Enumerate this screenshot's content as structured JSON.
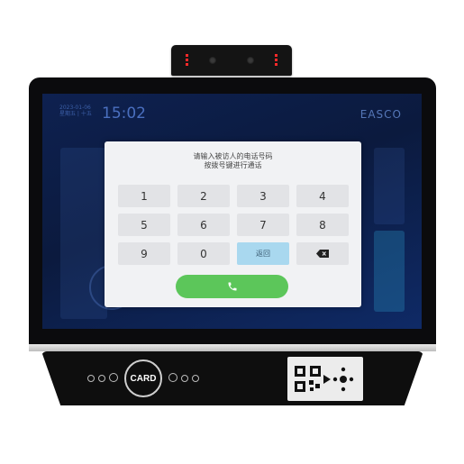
{
  "background": {
    "date": "2023-01-06",
    "weekday_lunar": "星期五 | 十五",
    "time": "15:02",
    "brand": "EASCO"
  },
  "dialog": {
    "prompt_line1": "请输入被访人的电话号码",
    "prompt_line2": "按拨号键进行通话",
    "keys": [
      "1",
      "2",
      "3",
      "4",
      "5",
      "6",
      "7",
      "8",
      "9",
      "0"
    ],
    "back_label": "返回",
    "delete_icon": "backspace-icon",
    "call_icon": "phone-icon"
  },
  "base": {
    "card_label": "CARD"
  },
  "colors": {
    "call_button": "#5cc65a",
    "back_button": "#a9d8ef",
    "screen_background": "#0b1a3e",
    "bezel": "#0b0b0d"
  }
}
